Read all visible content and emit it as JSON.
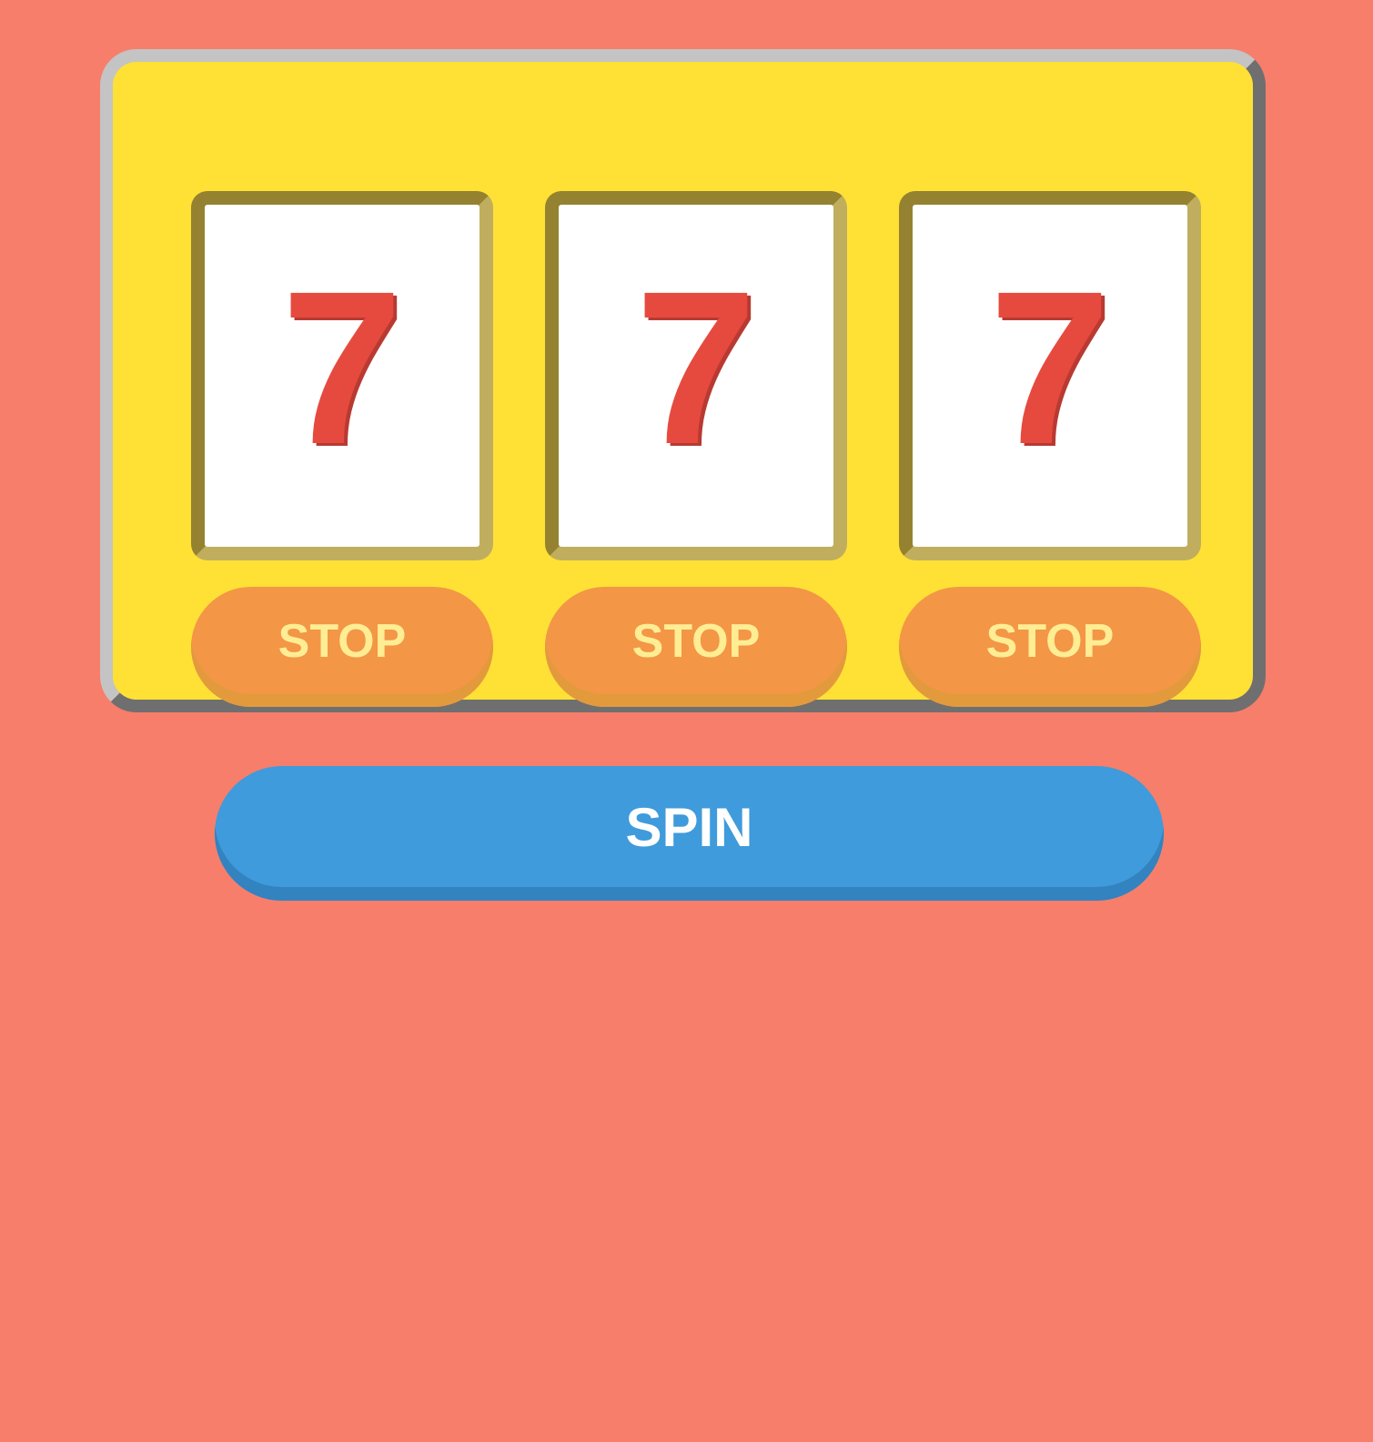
{
  "reels": [
    {
      "symbol": "7",
      "stop_label": "STOP"
    },
    {
      "symbol": "7",
      "stop_label": "STOP"
    },
    {
      "symbol": "7",
      "stop_label": "STOP"
    }
  ],
  "spin_label": "SPIN",
  "colors": {
    "background": "#f77e6b",
    "machine": "#ffe135",
    "reel_window": "#ffffff",
    "symbol": "#e64a3f",
    "stop_button": "#f39646",
    "stop_text": "#ffed94",
    "spin_button": "#3f9bdb",
    "spin_text": "#ffffff"
  }
}
